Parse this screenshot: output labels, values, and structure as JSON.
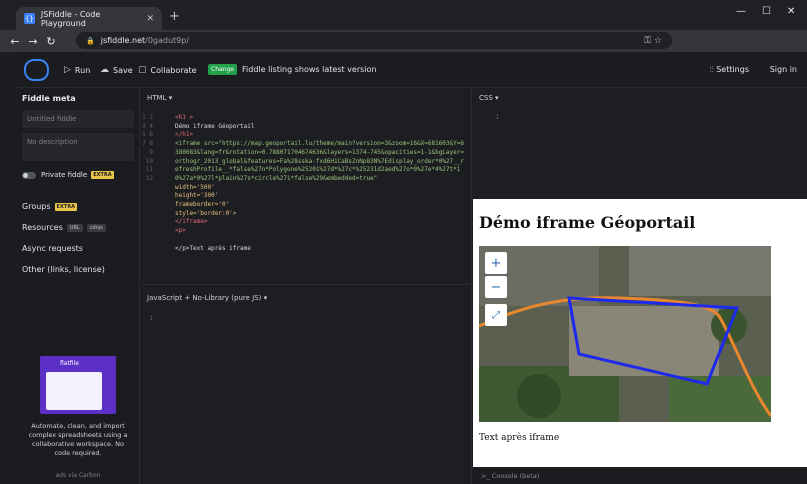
{
  "browser": {
    "tab_title": "JSFiddle - Code Playground",
    "url_domain": "jsfiddle.net",
    "url_path": "/0gadut9p/"
  },
  "toolbar": {
    "run_label": "Run",
    "save_label": "Save",
    "collaborate_label": "Collaborate",
    "change_badge": "Change",
    "listing_text": "Fiddle listing shows latest version",
    "settings_label": "Settings",
    "signin_label": "Sign in"
  },
  "sidebar": {
    "heading": "Fiddle meta",
    "title_placeholder": "Untitled fiddle",
    "description_placeholder": "No description",
    "private_label": "Private fiddle",
    "extra_badge": "EXTRA",
    "groups_label": "Groups",
    "resources_label": "Resources",
    "url_badge": "URL",
    "cdnjs_badge": "cdnjs",
    "async_label": "Async requests",
    "other_label": "Other (links, license)",
    "ad_brand": "flatfile",
    "ad_text": "Automate, clean, and import complex spreadsheets using a collaborative workspace. No code required.",
    "ad_via": "ads via Carbon"
  },
  "panes": {
    "html_label": "HTML ▾",
    "css_label": "CSS ▾",
    "js_label": "JavaScript + No-Library (pure JS) ▾",
    "console_label": "Console (beta)"
  },
  "html_code": [
    "<h1 >",
    "Démo iframe Géoportail",
    "</h1>",
    "<iframe src=\"https://map.geoportail.lu/theme/main?version=3&zoom=16&X=681603&Y=6380083&lang=fr&rotation=0.788071704674636&layers=1374-745&opacities=1-1&bgLayer=orthogr_2013_global&features=Fa%28sska-fxd6H1CaBsZnNp83N%7Edisplay_order*0%27__refreshProfile__*false%27n*Polygone%25201%27d*%27c*%25231d2aed%27o*0%27e*4%27t*10%27a*0%27l*plain%27s*circle%27i*false%29&embedded=true\"",
    "width='500'",
    "height='300'",
    "frameborder='0'",
    "style='border:0'>",
    "</iframe>",
    "<p>",
    "",
    "</p>Text après iframe"
  ],
  "result": {
    "heading": "Démo iframe Géoportail",
    "after_text": "Text après iframe",
    "zoom_in": "+",
    "zoom_out": "−"
  },
  "colors": {
    "accent": "#3b82f6",
    "change_green": "#23a04a",
    "extra_yellow": "#e8c547",
    "polygon_blue": "#1d2aed",
    "road_orange": "#e8872e"
  }
}
